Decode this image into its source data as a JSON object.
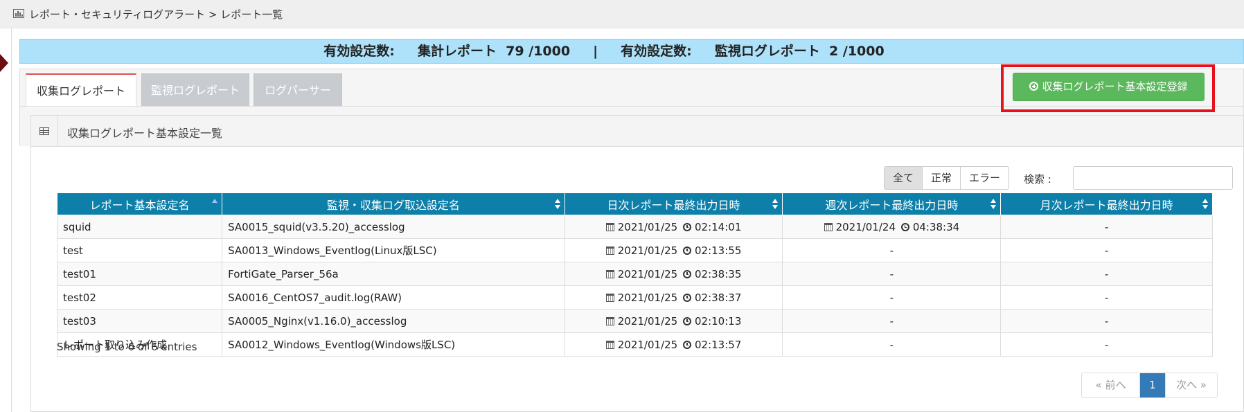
{
  "breadcrumb": {
    "text": "レポート・セキュリティログアラート > レポート一覧",
    "icon": "bar-chart-icon"
  },
  "info_bar": {
    "text": "有効設定数:     集計レポート  79 /1000     |     有効設定数:     監視ログレポート  2 /1000"
  },
  "tabs": [
    {
      "label": "収集ログレポート",
      "active": true
    },
    {
      "label": "監視ログレポート",
      "active": false
    },
    {
      "label": "ログパーサー",
      "active": false
    }
  ],
  "add_button": {
    "label": "収集ログレポート基本設定登録",
    "icon": "plus-circle-icon",
    "color": "#5cb85c",
    "highlight_color": "#e8111b"
  },
  "panel": {
    "title": "収集ログレポート基本設定一覧",
    "icon": "table-icon"
  },
  "filters": [
    "全て",
    "正常",
    "エラー"
  ],
  "search": {
    "label": "検索 :",
    "value": ""
  },
  "table": {
    "columns": [
      "レポート基本設定名",
      "監視・収集ログ取込設定名",
      "日次レポート最終出力日時",
      "週次レポート最終出力日時",
      "月次レポート最終出力日時"
    ],
    "header_color": "#0d7fa9",
    "rows": [
      {
        "name": "squid",
        "source": "SA0015_squid(v3.5.20)_accesslog",
        "daily_date": "2021/01/25",
        "daily_time": "02:14:01",
        "weekly_date": "2021/01/24",
        "weekly_time": "04:38:34",
        "weekly": "",
        "monthly": "-"
      },
      {
        "name": "test",
        "source": "SA0013_Windows_Eventlog(Linux版LSC)",
        "daily_date": "2021/01/25",
        "daily_time": "02:13:55",
        "weekly_date": "",
        "weekly_time": "",
        "weekly": "-",
        "monthly": "-"
      },
      {
        "name": "test01",
        "source": "FortiGate_Parser_56a",
        "daily_date": "2021/01/25",
        "daily_time": "02:38:35",
        "weekly_date": "",
        "weekly_time": "",
        "weekly": "-",
        "monthly": "-"
      },
      {
        "name": "test02",
        "source": "SA0016_CentOS7_audit.log(RAW)",
        "daily_date": "2021/01/25",
        "daily_time": "02:38:37",
        "weekly_date": "",
        "weekly_time": "",
        "weekly": "-",
        "monthly": "-"
      },
      {
        "name": "test03",
        "source": "SA0005_Nginx(v1.16.0)_accesslog",
        "daily_date": "2021/01/25",
        "daily_time": "02:10:13",
        "weekly_date": "",
        "weekly_time": "",
        "weekly": "-",
        "monthly": "-"
      },
      {
        "name": "レポート取り込み作成",
        "source": "SA0012_Windows_Eventlog(Windows版LSC)",
        "daily_date": "2021/01/25",
        "daily_time": "02:13:57",
        "weekly_date": "",
        "weekly_time": "",
        "weekly": "-",
        "monthly": "-"
      }
    ]
  },
  "entries_text": "Showing 1 to 6 of 6 entries",
  "pagination": {
    "prev": "« 前へ",
    "current": "1",
    "next": "次へ »"
  }
}
